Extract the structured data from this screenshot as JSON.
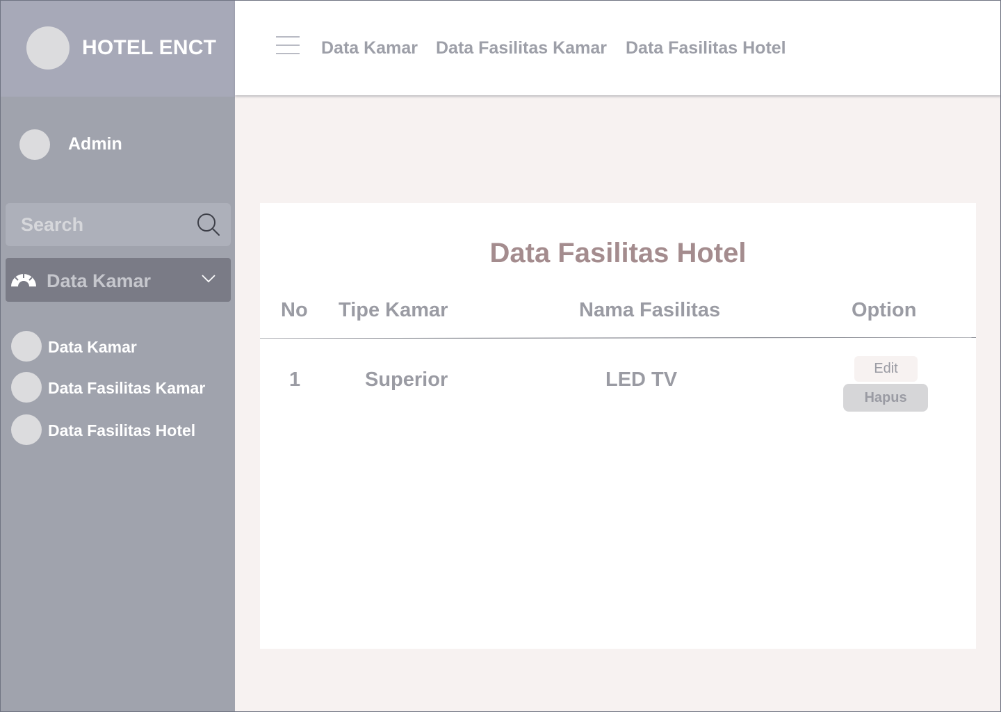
{
  "brand": {
    "title": "HOTEL ENCT"
  },
  "user": {
    "name": "Admin"
  },
  "search": {
    "placeholder": "Search"
  },
  "sidebar": {
    "dropdown_label": "Data Kamar",
    "items": [
      {
        "label": "Data Kamar"
      },
      {
        "label": "Data Fasilitas Kamar"
      },
      {
        "label": "Data Fasilitas Hotel"
      }
    ]
  },
  "topnav": {
    "items": [
      {
        "label": "Data Kamar"
      },
      {
        "label": "Data Fasilitas Kamar"
      },
      {
        "label": "Data Fasilitas Hotel"
      }
    ]
  },
  "main": {
    "title": "Data Fasilitas Hotel",
    "columns": [
      "No",
      "Tipe Kamar",
      "Nama Fasilitas",
      "Option"
    ],
    "rows": [
      {
        "no": "1",
        "tipe_kamar": "Superior",
        "nama_fasilitas": "LED TV"
      }
    ],
    "edit_label": "Edit",
    "delete_label": "Hapus"
  },
  "colors": {
    "sidebar_bg": "#a0a3ad",
    "brand_bg": "#a7a9b8",
    "title_accent": "#a48c8e",
    "content_bg": "#f7f2f1"
  }
}
